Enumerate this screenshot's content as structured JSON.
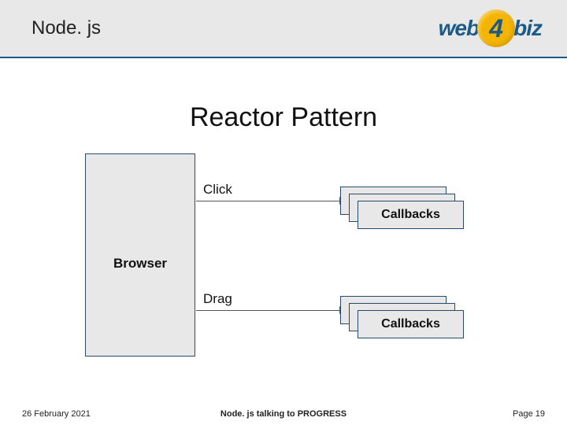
{
  "header": {
    "title": "Node. js",
    "logo": {
      "left": "web",
      "num": "4",
      "right": "biz"
    }
  },
  "main": {
    "title": "Reactor Pattern",
    "browser_label": "Browser",
    "events": {
      "click": {
        "label": "Click",
        "callbacks_label": "Callbacks"
      },
      "drag": {
        "label": "Drag",
        "callbacks_label": "Callbacks"
      }
    }
  },
  "footer": {
    "date": "26 February 2021",
    "center": "Node. js talking to PROGRESS",
    "page": "Page 19"
  }
}
